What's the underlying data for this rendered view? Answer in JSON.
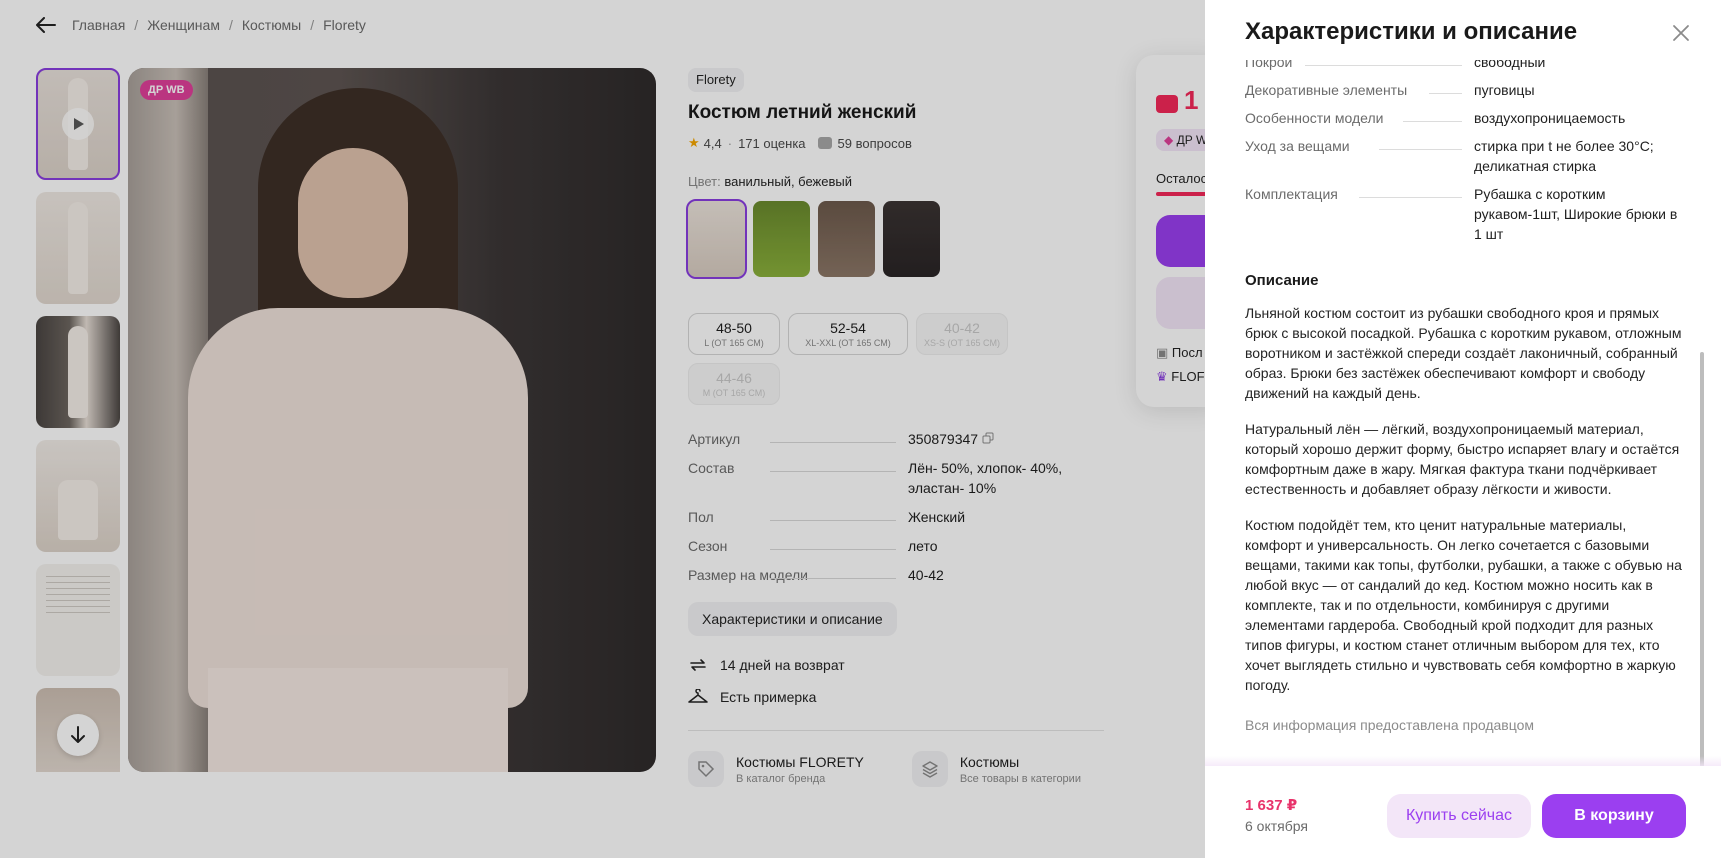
{
  "breadcrumb": {
    "items": [
      "Главная",
      "Женщинам",
      "Костюмы",
      "Florety"
    ],
    "separator": "/"
  },
  "gallery": {
    "badge": "ДР WB"
  },
  "product": {
    "brand": "Florety",
    "title": "Костюм летний женский",
    "rating": "4,4",
    "ratings_count": "171 оценка",
    "questions": "59 вопросов",
    "color_label": "Цвет:",
    "color_value": "ванильный, бежевый",
    "sizes": [
      {
        "num": "48-50",
        "sub": "L (ОТ 165 СМ)"
      },
      {
        "num": "52-54",
        "sub": "XL-XXL (ОТ 165 СМ)"
      },
      {
        "num": "40-42",
        "sub": "XS-S (ОТ 165 СМ)"
      },
      {
        "num": "44-46",
        "sub": "M (ОТ 165 СМ)"
      }
    ],
    "specs": [
      {
        "k": "Артикул",
        "v": "350879347"
      },
      {
        "k": "Состав",
        "v": "Лён- 50%, хлопок- 40%, эластан- 10%"
      },
      {
        "k": "Пол",
        "v": "Женский"
      },
      {
        "k": "Сезон",
        "v": "лето"
      },
      {
        "k": "Размер на модели",
        "v": "40-42"
      }
    ],
    "char_button": "Характеристики и описание",
    "perks": [
      "14 дней на возврат",
      "Есть примерка"
    ],
    "links": [
      {
        "title": "Костюмы FLORETY",
        "sub": "В каталог бренда"
      },
      {
        "title": "Костюмы",
        "sub": "Все товары в категории"
      }
    ]
  },
  "buy_card": {
    "price_partial": "1",
    "dr_partial": "ДР W",
    "left_partial": "Осталос",
    "line1_partial": "Посл",
    "line2_partial": "FLOF",
    "accent": "#F5285A"
  },
  "drawer": {
    "title": "Характеристики и описание",
    "specs": [
      {
        "k": "Покрой",
        "v": "свободный"
      },
      {
        "k": "Декоративные элементы",
        "v": "пуговицы"
      },
      {
        "k": "Особенности модели",
        "v": "воздухопроницаемость"
      },
      {
        "k": "Уход за вещами",
        "v": "стирка при t не более 30°С; деликатная стирка"
      },
      {
        "k": "Комплектация",
        "v": "Рубашка с коротким рукавом-1шт, Широкие брюки в 1 шт"
      }
    ],
    "description_heading": "Описание",
    "paragraphs": [
      "Льняной костюм состоит из рубашки свободного кроя и прямых брюк с высокой посадкой. Рубашка с коротким рукавом, отложным воротником и застёжкой спереди создаёт лаконичный, собранный образ. Брюки без застёжек обеспечивают комфорт и свободу движений на каждый день.",
      "Натуральный лён — лёгкий, воздухопроницаемый материал, который хорошо держит форму, быстро испаряет влагу и остаётся комфортным даже в жару. Мягкая фактура ткани подчёркивает естественность и добавляет образу лёгкости и живости.",
      "Костюм подойдёт тем, кто ценит натуральные материалы, комфорт и универсальность. Он легко сочетается с базовыми вещами, такими как топы, футболки, рубашки, а также с обувью на любой вкус — от сандалий до кед. Костюм можно носить как в комплекте, так и по отдельности, комбинируя с другими элементами гардероба. Свободный крой подходит для разных типов фигуры, и костюм станет отличным выбором для тех, кто хочет выглядеть стильно и чувствовать себя комфортно в жаркую погоду."
    ],
    "seller_note": "Вся информация предоставлена продавцом",
    "price": "1 637 ₽",
    "date": "6 октября",
    "buy_now": "Купить сейчас",
    "to_cart": "В корзину",
    "accent": "#9B3FF0"
  }
}
